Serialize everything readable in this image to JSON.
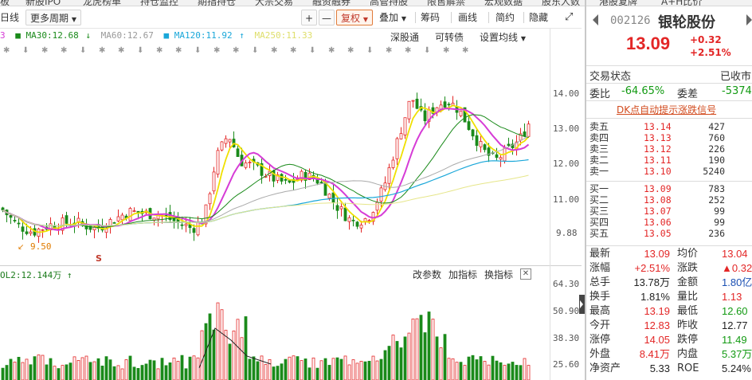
{
  "nav": {
    "items": [
      "板",
      "新股IPO",
      "龙虎榜单",
      "持仓监控",
      "期指持仓",
      "大宗交易",
      "融资融券",
      "高管持股",
      "限售解禁",
      "宏观数据",
      "股东人数"
    ],
    "right_items": [
      "港股复牌",
      "A+H比价"
    ]
  },
  "toolbar": {
    "period": "日线",
    "more_period": "更多周期",
    "plus": "+",
    "minus": "—",
    "fuquan": "复权",
    "overlay": "叠加",
    "chips": "筹码",
    "draw": "画线",
    "simple": "简约",
    "hide": "隐藏",
    "fullscreen": "⤢"
  },
  "ma_legend": {
    "ma_prefix": "3",
    "ma30": "MA30:12.68",
    "ma60": "MA60:12.67",
    "ma120": "MA120:11.92",
    "ma250": "MA250:11.33",
    "colors": {
      "ma30": "#1a8a1a",
      "ma60": "#9a9a9a",
      "ma120": "#1aa7d9",
      "ma250": "#d9d94a"
    }
  },
  "chart_links": {
    "sgt": "深股通",
    "convertible": "可转债",
    "set_ma": "设置均线"
  },
  "price_axis": {
    "ticks": [
      "14.00",
      "13.00",
      "12.00",
      "11.00",
      "9.88"
    ]
  },
  "annotations": {
    "low_label": "9.50",
    "s_marker": "S"
  },
  "volume": {
    "legend": "OL2:12.144万 ↑",
    "change_params": "改参数",
    "add_indicator": "加指标",
    "switch_indicator": "换指标",
    "close": "✕",
    "axis_ticks": [
      "64.30",
      "50.90",
      "38.30",
      "25.60"
    ]
  },
  "quote": {
    "top_items": [
      "港股复牌"
    ],
    "code": "002126",
    "name": "银轮股份",
    "price": "13.09",
    "change": "+0.32",
    "change_pct": "+2.51%",
    "trade_status_label": "交易状态",
    "trade_status_value": "已收市",
    "webi_label": "委比",
    "webi_value": "-64.65%",
    "weicha_label": "委差",
    "weicha_value": "-5374",
    "announcement": "DK点自动提示涨跌信号",
    "asks": [
      {
        "label": "卖五",
        "price": "13.14",
        "vol": "427"
      },
      {
        "label": "卖四",
        "price": "13.13",
        "vol": "760"
      },
      {
        "label": "卖三",
        "price": "13.12",
        "vol": "226"
      },
      {
        "label": "卖二",
        "price": "13.11",
        "vol": "190"
      },
      {
        "label": "卖一",
        "price": "13.10",
        "vol": "5240"
      }
    ],
    "bids": [
      {
        "label": "买一",
        "price": "13.09",
        "vol": "783"
      },
      {
        "label": "买二",
        "price": "13.08",
        "vol": "252"
      },
      {
        "label": "买三",
        "price": "13.07",
        "vol": "99"
      },
      {
        "label": "买四",
        "price": "13.06",
        "vol": "99"
      },
      {
        "label": "买五",
        "price": "13.05",
        "vol": "236"
      }
    ],
    "stats": [
      {
        "k1": "最新",
        "v1": "13.09",
        "c1": "red",
        "k2": "均价",
        "v2": "13.04",
        "c2": "red"
      },
      {
        "k1": "涨幅",
        "v1": "+2.51%",
        "c1": "red",
        "k2": "涨跌",
        "v2": "▲0.32",
        "c2": "red"
      },
      {
        "k1": "总手",
        "v1": "13.78万",
        "c1": "dark",
        "k2": "金额",
        "v2": "1.80亿",
        "c2": "blue"
      },
      {
        "k1": "换手",
        "v1": "1.81%",
        "c1": "dark",
        "k2": "量比",
        "v2": "1.13",
        "c2": "red"
      },
      {
        "k1": "最高",
        "v1": "13.19",
        "c1": "red",
        "k2": "最低",
        "v2": "12.60",
        "c2": "green"
      },
      {
        "k1": "今开",
        "v1": "12.83",
        "c1": "red",
        "k2": "昨收",
        "v2": "12.77",
        "c2": "dark"
      },
      {
        "k1": "涨停",
        "v1": "14.05",
        "c1": "red",
        "k2": "跌停",
        "v2": "11.49",
        "c2": "green"
      },
      {
        "k1": "外盘",
        "v1": "8.41万",
        "c1": "red",
        "k2": "内盘",
        "v2": "5.37万",
        "c2": "green"
      },
      {
        "k1": "净资产",
        "v1": "5.33",
        "c1": "dark",
        "k2": "ROE",
        "v2": "5.24%",
        "c2": "dark"
      }
    ]
  }
}
